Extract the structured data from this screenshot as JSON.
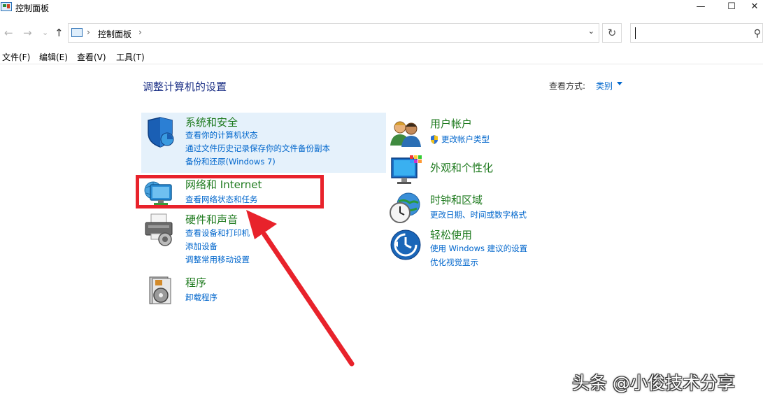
{
  "window": {
    "title": "控制面板",
    "minimize": "—",
    "maximize": "☐",
    "close": "✕"
  },
  "nav": {
    "back": "←",
    "forward": "→",
    "recent": "⌄",
    "up": "↑"
  },
  "address": {
    "breadcrumb_sep": "›",
    "path": "控制面板",
    "trail_sep": "›",
    "dropdown": "⌄",
    "refresh": "↻"
  },
  "search": {
    "icon": "⚲"
  },
  "menu": {
    "items": [
      "文件(F)",
      "编辑(E)",
      "查看(V)",
      "工具(T)"
    ]
  },
  "main": {
    "heading": "调整计算机的设置",
    "view_by_label": "查看方式:",
    "view_by_value": "类别"
  },
  "categories": {
    "left": [
      {
        "title": "系统和安全",
        "icon": "shield-icon",
        "links": [
          "查看你的计算机状态",
          "通过文件历史记录保存你的文件备份副本",
          "备份和还原(Windows 7)"
        ]
      },
      {
        "title": "网络和 Internet",
        "icon": "network-icon",
        "links": [
          "查看网络状态和任务"
        ]
      },
      {
        "title": "硬件和声音",
        "icon": "printer-icon",
        "links": [
          "查看设备和打印机",
          "添加设备",
          "调整常用移动设置"
        ]
      },
      {
        "title": "程序",
        "icon": "programs-icon",
        "links": [
          "卸载程序"
        ]
      }
    ],
    "right": [
      {
        "title": "用户帐户",
        "icon": "users-icon",
        "links": [
          "更改帐户类型"
        ]
      },
      {
        "title": "外观和个性化",
        "icon": "monitor-icon",
        "links": []
      },
      {
        "title": "时钟和区域",
        "icon": "clock-globe-icon",
        "links": [
          "更改日期、时间或数字格式"
        ]
      },
      {
        "title": "轻松使用",
        "icon": "accessibility-icon",
        "links": [
          "使用 Windows 建议的设置",
          "优化视觉显示"
        ]
      }
    ]
  },
  "colors": {
    "category_title": "#1e7a1e",
    "link": "#0066cc",
    "heading": "#1e3287",
    "annotation": "#e8222b",
    "hover_bg": "#e5f1fb"
  },
  "watermark": "头条 @小俊技术分享"
}
